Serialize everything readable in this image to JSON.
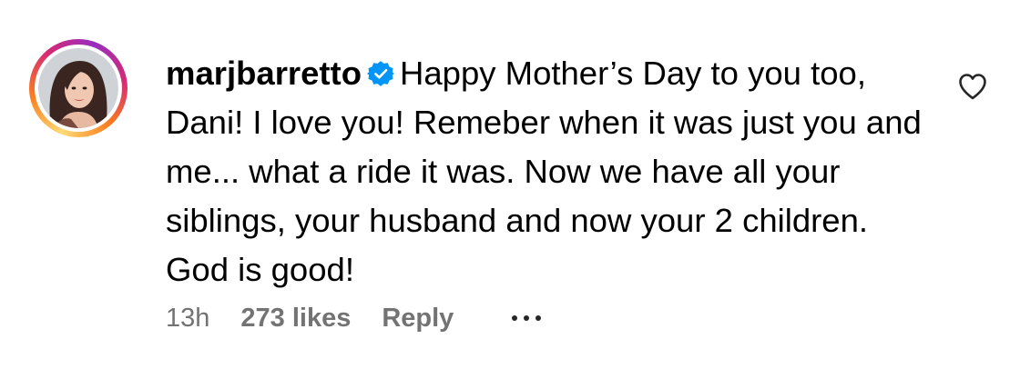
{
  "comment": {
    "username": "marjbarretto",
    "verified": true,
    "avatar_icon": "profile-photo-avatar",
    "text": "Happy Mother’s Day to you too, Dani! I love you! Remeber when it was just you and me... what a ride it was. Now we have all your siblings, your husband and now your 2 children. God is good!",
    "time": "13h",
    "likes": "273 likes",
    "reply_label": "Reply",
    "more_icon": "more-options-icon",
    "like_icon": "heart-outline-icon"
  },
  "colors": {
    "verified_badge": "#0095f6",
    "meta_text": "#737373",
    "text": "#000000",
    "story_ring": [
      "#feda75",
      "#fa7e1e",
      "#d62976",
      "#962fbf"
    ]
  }
}
